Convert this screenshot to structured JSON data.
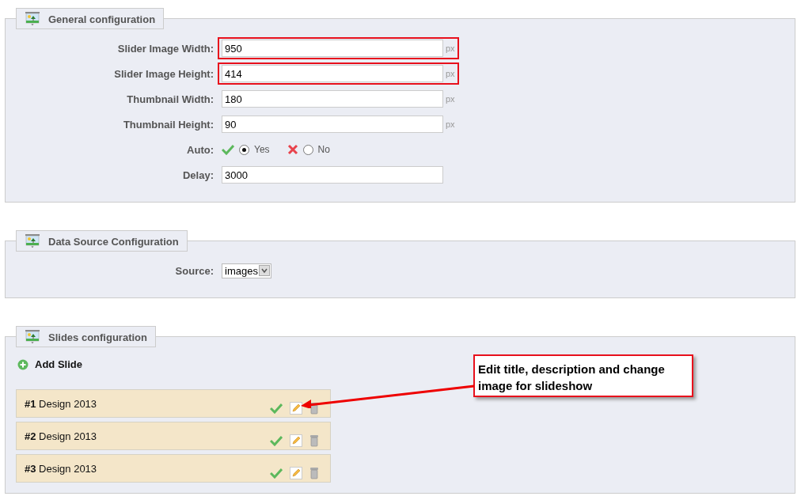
{
  "sections": [
    {
      "kind": "form",
      "title": "General configuration",
      "fields": [
        {
          "kind": "text",
          "label": "Slider Image Width:",
          "value": "950",
          "unit": "px",
          "highlighted": true
        },
        {
          "kind": "text",
          "label": "Slider Image Height:",
          "value": "414",
          "unit": "px",
          "highlighted": true
        },
        {
          "kind": "text",
          "label": "Thumbnail Width:",
          "value": "180",
          "unit": "px",
          "highlighted": false
        },
        {
          "kind": "text",
          "label": "Thumbnail Height:",
          "value": "90",
          "unit": "px",
          "highlighted": false
        },
        {
          "kind": "radio",
          "label": "Auto:",
          "options": [
            {
              "label": "Yes",
              "selected": true
            },
            {
              "label": "No",
              "selected": false
            }
          ]
        },
        {
          "kind": "text",
          "label": "Delay:",
          "value": "3000",
          "highlighted": false
        }
      ]
    },
    {
      "kind": "form",
      "title": "Data Source Configuration",
      "fields": [
        {
          "kind": "select",
          "label": "Source:",
          "value": "images"
        }
      ]
    },
    {
      "kind": "slides",
      "title": "Slides configuration",
      "add_label": "Add Slide",
      "slides": [
        {
          "title": "**#1** Design 2013"
        },
        {
          "title": "**#2** Design 2013"
        },
        {
          "title": "**#3** Design 2013"
        }
      ]
    }
  ],
  "callout": {
    "text": "Edit title, description and change image for slideshow"
  }
}
